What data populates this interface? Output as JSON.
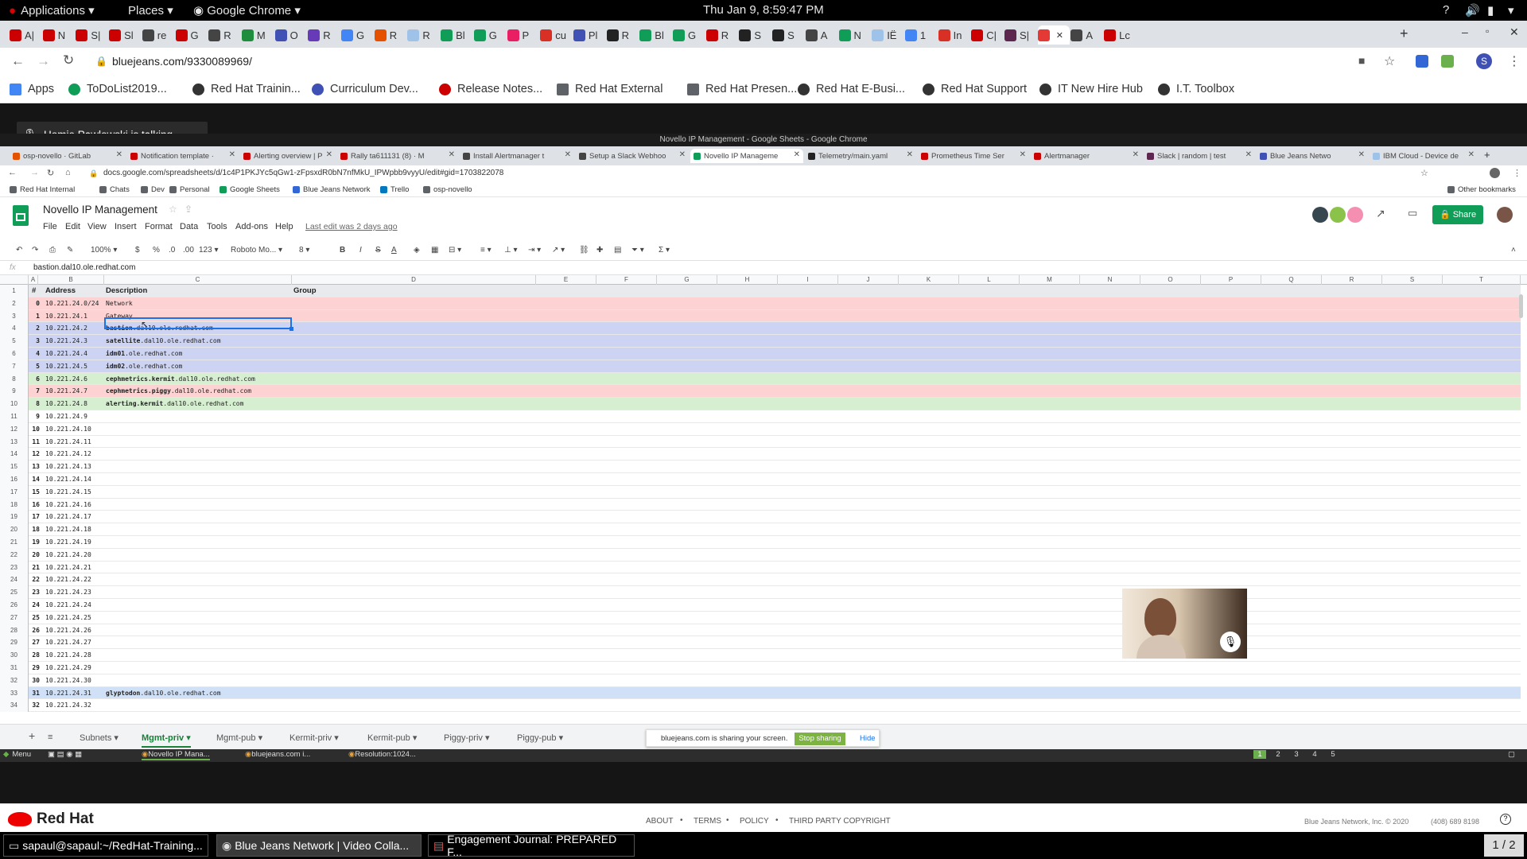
{
  "os_bar": {
    "applications": "Applications",
    "places": "Places",
    "browser": "Google Chrome",
    "clock": "Thu Jan  9,  8:59:47 PM"
  },
  "outer_browser": {
    "tabs": [
      "A|",
      "N",
      "S|",
      "Sl",
      "re",
      "G",
      "R",
      "M",
      "O",
      "R",
      "G",
      "R",
      "R",
      "Bl",
      "G",
      "P",
      "cu",
      "Pl",
      "R",
      "Bl",
      "G",
      "R",
      "S",
      "S",
      "A",
      "N",
      "IË",
      "1",
      "In",
      "C|",
      "S|",
      "",
      "A",
      "Lc"
    ],
    "url": "bluejeans.com/9330089969/",
    "bookmarks": [
      "Apps",
      "ToDoList2019...",
      "Red Hat Trainin...",
      "Curriculum Dev...",
      "Release Notes...",
      "Red Hat External",
      "Red Hat Presen...",
      "Red Hat E-Busi...",
      "Red Hat Support",
      "IT New Hire Hub",
      "I.T. Toolbox"
    ],
    "profile_initial": "S"
  },
  "share": {
    "talking": "Homie Pawlowski is talking",
    "sharing_notice": "bluejeans.com is sharing your screen.",
    "stop_sharing": "Stop sharing",
    "hide": "Hide"
  },
  "inner_browser": {
    "window_title": "Novello IP Management - Google Sheets - Google Chrome",
    "tabs": [
      "osp-novello · GitLab",
      "Notification template ·",
      "Alerting overview | P",
      "Rally ta611131 (8) · M",
      "Install Alertmanager t",
      "Setup a Slack Webhoo",
      "Novello IP Manageme",
      "Telemetry/main.yaml",
      "Prometheus Time Ser",
      "Alertmanager",
      "Slack | random | test",
      "Blue Jeans Netwo",
      "IBM Cloud - Device de"
    ],
    "url": "docs.google.com/spreadsheets/d/1c4P1PKJYc5qGw1-zFpsxdR0bN7nfMkU_IPWpbb9vyyU/edit#gid=1703822078",
    "bookmarks": [
      "Red Hat Internal",
      "Chats",
      "Dev",
      "Personal",
      "Google Sheets",
      "Blue Jeans Network",
      "Trello",
      "osp-novello"
    ],
    "other_bookmarks": "Other bookmarks"
  },
  "sheets": {
    "doc_title": "Novello IP Management",
    "menu": [
      "File",
      "Edit",
      "View",
      "Insert",
      "Format",
      "Data",
      "Tools",
      "Add-ons",
      "Help"
    ],
    "last_edit": "Last edit was 2 days ago",
    "share_label": "Share",
    "toolbar": {
      "zoom": "100%",
      "currency": "$",
      "percent": "%",
      "dec_less": ".0",
      "dec_more": ".00",
      "format": "123",
      "font": "Roboto Mo...",
      "size": "8",
      "bold": "B",
      "italic": "I",
      "strike": "S",
      "text_color": "A"
    },
    "formula_value": "bastion.dal10.ole.redhat.com",
    "columns": [
      "A",
      "B",
      "C",
      "D",
      "E",
      "F",
      "G",
      "H",
      "I",
      "J",
      "K",
      "L",
      "M",
      "N",
      "O",
      "P",
      "Q",
      "R",
      "S",
      "T"
    ],
    "header_row": {
      "num": "#",
      "address": "Address",
      "description": "Description",
      "group": "Group"
    },
    "rows": [
      {
        "n": "0",
        "addr": "10.221.24.0/24",
        "bold": "",
        "rest": "Network",
        "color": "#fcd2d2"
      },
      {
        "n": "1",
        "addr": "10.221.24.1",
        "bold": "",
        "rest": "Gateway",
        "color": "#fcd2d2"
      },
      {
        "n": "2",
        "addr": "10.221.24.2",
        "bold": "bastion",
        "rest": ".dal10.ole.redhat.com",
        "color": "#cdd3f3"
      },
      {
        "n": "3",
        "addr": "10.221.24.3",
        "bold": "satellite",
        "rest": ".dal10.ole.redhat.com",
        "color": "#cdd3f3"
      },
      {
        "n": "4",
        "addr": "10.221.24.4",
        "bold": "idm01",
        "rest": ".ole.redhat.com",
        "color": "#cdd3f3"
      },
      {
        "n": "5",
        "addr": "10.221.24.5",
        "bold": "idm02",
        "rest": ".ole.redhat.com",
        "color": "#cdd3f3"
      },
      {
        "n": "6",
        "addr": "10.221.24.6",
        "bold": "cephmetrics.kermit",
        "rest": ".dal10.ole.redhat.com",
        "color": "#d6efd1"
      },
      {
        "n": "7",
        "addr": "10.221.24.7",
        "bold": "cephmetrics.piggy",
        "rest": ".dal10.ole.redhat.com",
        "color": "#fcd2d2"
      },
      {
        "n": "8",
        "addr": "10.221.24.8",
        "bold": "alerting.kermit",
        "rest": ".dal10.ole.redhat.com",
        "color": "#d6efd1"
      },
      {
        "n": "9",
        "addr": "10.221.24.9",
        "bold": "",
        "rest": "",
        "color": ""
      },
      {
        "n": "10",
        "addr": "10.221.24.10",
        "bold": "",
        "rest": "",
        "color": ""
      },
      {
        "n": "11",
        "addr": "10.221.24.11",
        "bold": "",
        "rest": "",
        "color": ""
      },
      {
        "n": "12",
        "addr": "10.221.24.12",
        "bold": "",
        "rest": "",
        "color": ""
      },
      {
        "n": "13",
        "addr": "10.221.24.13",
        "bold": "",
        "rest": "",
        "color": ""
      },
      {
        "n": "14",
        "addr": "10.221.24.14",
        "bold": "",
        "rest": "",
        "color": ""
      },
      {
        "n": "15",
        "addr": "10.221.24.15",
        "bold": "",
        "rest": "",
        "color": ""
      },
      {
        "n": "16",
        "addr": "10.221.24.16",
        "bold": "",
        "rest": "",
        "color": ""
      },
      {
        "n": "17",
        "addr": "10.221.24.17",
        "bold": "",
        "rest": "",
        "color": ""
      },
      {
        "n": "18",
        "addr": "10.221.24.18",
        "bold": "",
        "rest": "",
        "color": ""
      },
      {
        "n": "19",
        "addr": "10.221.24.19",
        "bold": "",
        "rest": "",
        "color": ""
      },
      {
        "n": "20",
        "addr": "10.221.24.20",
        "bold": "",
        "rest": "",
        "color": ""
      },
      {
        "n": "21",
        "addr": "10.221.24.21",
        "bold": "",
        "rest": "",
        "color": ""
      },
      {
        "n": "22",
        "addr": "10.221.24.22",
        "bold": "",
        "rest": "",
        "color": ""
      },
      {
        "n": "23",
        "addr": "10.221.24.23",
        "bold": "",
        "rest": "",
        "color": ""
      },
      {
        "n": "24",
        "addr": "10.221.24.24",
        "bold": "",
        "rest": "",
        "color": ""
      },
      {
        "n": "25",
        "addr": "10.221.24.25",
        "bold": "",
        "rest": "",
        "color": ""
      },
      {
        "n": "26",
        "addr": "10.221.24.26",
        "bold": "",
        "rest": "",
        "color": ""
      },
      {
        "n": "27",
        "addr": "10.221.24.27",
        "bold": "",
        "rest": "",
        "color": ""
      },
      {
        "n": "28",
        "addr": "10.221.24.28",
        "bold": "",
        "rest": "",
        "color": ""
      },
      {
        "n": "29",
        "addr": "10.221.24.29",
        "bold": "",
        "rest": "",
        "color": ""
      },
      {
        "n": "30",
        "addr": "10.221.24.30",
        "bold": "",
        "rest": "",
        "color": ""
      },
      {
        "n": "31",
        "addr": "10.221.24.31",
        "bold": "glyptodon",
        "rest": ".dal10.ole.redhat.com",
        "color": "#cfe0f7"
      },
      {
        "n": "32",
        "addr": "10.221.24.32",
        "bold": "",
        "rest": "",
        "color": ""
      }
    ],
    "sheet_tabs": [
      "Subnets",
      "Mgmt-priv",
      "Mgmt-pub",
      "Kermit-priv",
      "Kermit-pub",
      "Piggy-priv",
      "Piggy-pub"
    ],
    "active_sheet": "Mgmt-priv"
  },
  "inner_taskbar": {
    "menu": "Menu",
    "items": [
      "Novello IP Mana...",
      "bluejeans.com i...",
      "Resolution:1024..."
    ],
    "workspaces": [
      "1",
      "2",
      "3",
      "4",
      "5"
    ]
  },
  "footer": {
    "brand": "Red Hat",
    "links": [
      "ABOUT",
      "TERMS",
      "POLICY",
      "THIRD PARTY COPYRIGHT"
    ],
    "copyright": "Blue Jeans Network, Inc. © 2020",
    "phone": "(408) 689 8198"
  },
  "taskbar": {
    "items": [
      "sapaul@sapaul:~/RedHat-Training...",
      "Blue Jeans Network | Video Colla...",
      "Engagement Journal: PREPARED F..."
    ],
    "pager": "1 / 2"
  },
  "colors": {
    "sheets_green": "#0f9d58",
    "share_blue": "#1a73e8",
    "selection": "#1a73e8"
  }
}
